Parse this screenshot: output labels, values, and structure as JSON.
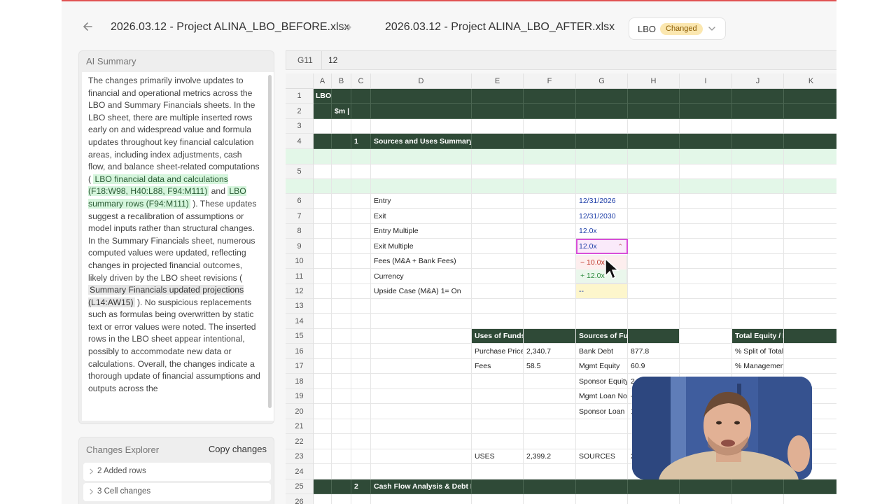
{
  "header": {
    "file_before": "2026.03.12 - Project ALINA_LBO_BEFORE.xlsx",
    "file_after": "2026.03.12 - Project ALINA_LBO_AFTER.xlsx",
    "sheet": "LBO",
    "badge": "Changed"
  },
  "summary": {
    "title": "AI Summary",
    "p1": "The changes primarily involve updates to financial and operational metrics across the LBO and Summary Financials sheets. In the LBO sheet, there are multiple inserted rows early on and widespread value and formula updates throughout key financial calculation areas, including index adjustments, cash flow, and balance sheet-related computations",
    "open1": "(",
    "ref1": "LBO financial data and calculations (F18:W98, H40:L88, F94:M111)",
    "and": "and",
    "ref2": "LBO summary rows (F94:M111)",
    "p2": "). These updates suggest a recalibration of assumptions or model inputs rather than structural changes. In the Summary Financials sheet, numerous computed values were updated, reflecting changes in projected financial outcomes, likely driven by the LBO sheet revisions",
    "open2": "(",
    "ref3": "Summary Financials updated projections (L14:AW15)",
    "p3": "). No suspicious replacements such as formulas being overwritten by static text or error values were noted. The inserted rows in the LBO sheet appear intentional, possibly to accommodate new data or calculations. Overall, the changes indicate a thorough update of financial assumptions and outputs across the"
  },
  "changes": {
    "title": "Changes Explorer",
    "copy": "Copy changes",
    "added_count": "2",
    "added_label": "Added rows",
    "cell_count": "3",
    "cell_label": "Cell changes"
  },
  "formula": {
    "ref": "G11",
    "value": "12"
  },
  "columns": [
    "A",
    "B",
    "C",
    "D",
    "E",
    "F",
    "G",
    "H",
    "I",
    "J",
    "K"
  ],
  "rows": {
    "r1": "1",
    "r2": "2",
    "r3": "3",
    "r4": "4",
    "r5": "5",
    "r6": "6",
    "r7": "7",
    "r8": "8",
    "r9": "9",
    "r10": "10",
    "r11": "11",
    "r12": "12",
    "r13": "13",
    "r14": "14",
    "r15": "15",
    "r16": "16",
    "r17": "17",
    "r18": "18",
    "r19": "19",
    "r20": "20",
    "r21": "21",
    "r22": "22",
    "r23": "23",
    "r24": "24",
    "r25": "25",
    "r26": "26"
  },
  "cells": {
    "a1": "LBO",
    "b2": "$m |",
    "c4": "1",
    "d4": "Sources and Uses Summary",
    "d6": "Entry",
    "g6": "12/31/2026",
    "d7": "Exit",
    "g7": "12/31/2030",
    "d8": "Entry Multiple",
    "g8": "12.0x",
    "d9": "Exit Multiple",
    "g9": "12.0x",
    "d10": "Fees (M&A + Bank Fees)",
    "d11": "Currency",
    "d12": "Upside Case (M&A) 1= On",
    "g12": "--",
    "e15": "Uses of Funds",
    "g15": "Sources of Funds",
    "j15": "Total Equity / LP",
    "e16": "Purchase Price",
    "f16": "2,340.7",
    "g16": "Bank Debt",
    "h16": "877.8",
    "j16": "% Split of Total",
    "e17": "Fees",
    "f17": "58.5",
    "g17": "Mgmt Equity",
    "h17": "60.9",
    "j17": "% Management",
    "g18": "Sponsor Equity",
    "h18": "242",
    "g19": "Mgmt Loan Notes",
    "h19": "-",
    "g20": "Sponsor Loan Notes",
    "h20": "1",
    "e23": "USES",
    "f23": "2,399.2",
    "g23": "SOURCES",
    "h23": "2",
    "c25": "2",
    "d25": "Cash Flow Analysis & Debt Paydown"
  },
  "dropdown": {
    "old": "− 10.0x",
    "new": "+ 12.0x"
  }
}
